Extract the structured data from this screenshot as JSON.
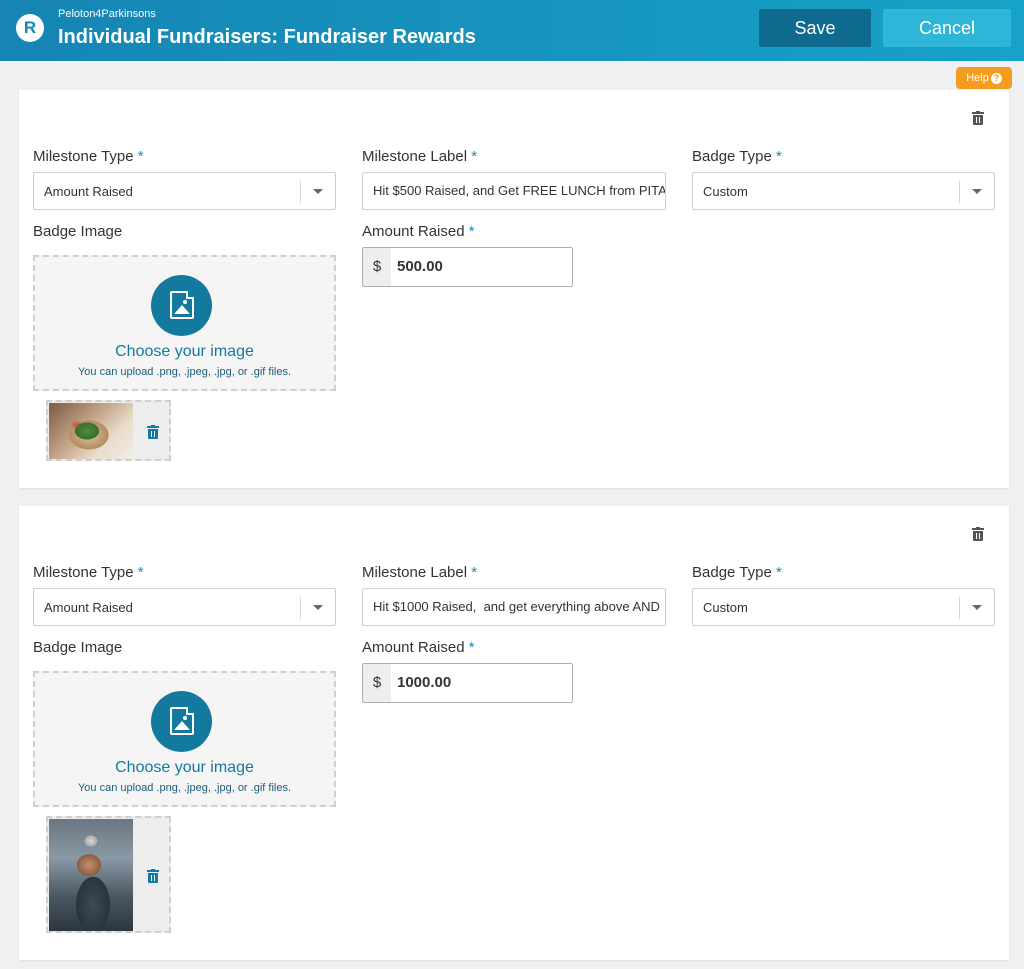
{
  "header": {
    "org_name": "Peloton4Parkinsons",
    "title": "Individual Fundraisers: Fundraiser Rewards",
    "logo_letter": "R",
    "save_label": "Save",
    "cancel_label": "Cancel",
    "colors": {
      "header_start": "#1585b3",
      "header_end": "#17a2c7",
      "save_bg": "#0e6b8f",
      "cancel_bg": "#2eb5d8"
    }
  },
  "help": {
    "label": "Help",
    "icon": "question-icon",
    "color": "#f39c1f"
  },
  "labels": {
    "milestone_type": "Milestone Type",
    "milestone_label": "Milestone Label",
    "badge_type": "Badge Type",
    "badge_image": "Badge Image",
    "amount_raised": "Amount Raised",
    "required_mark": "*"
  },
  "dropzone": {
    "title": "Choose your image",
    "hint": "You can upload .png, .jpeg, .jpg, or .gif files.",
    "icon": "image-icon"
  },
  "rewards": [
    {
      "milestone_type": "Amount Raised",
      "milestone_label": "Hit $500 Raised, and Get FREE LUNCH from PITA",
      "badge_type": "Custom",
      "currency": "$",
      "amount": "500.00",
      "badge_thumbnail": "food-wrap-photo"
    },
    {
      "milestone_type": "Amount Raised",
      "milestone_label": "Hit $1000 Raised,  and get everything above AND",
      "badge_type": "Custom",
      "currency": "$",
      "amount": "1000.00",
      "badge_thumbnail": "gym-person-photo"
    }
  ]
}
